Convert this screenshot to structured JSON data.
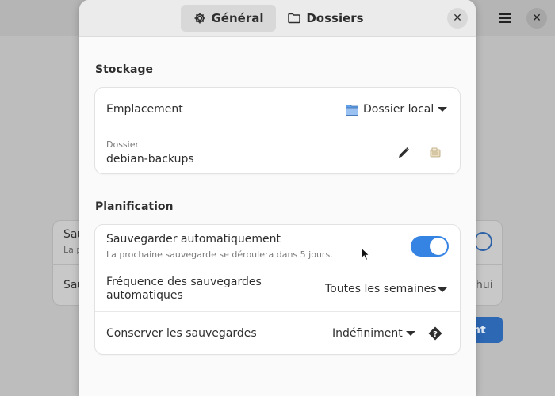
{
  "background": {
    "row1_label": "Sau",
    "row1_sub": "La p",
    "row2_label": "Sau",
    "row2_value": "hui",
    "button_label": "nt"
  },
  "dialog": {
    "tabs": [
      {
        "label": "Général",
        "icon": "gear-icon",
        "active": true
      },
      {
        "label": "Dossiers",
        "icon": "folder-icon",
        "active": false
      }
    ],
    "close_icon": "close-icon"
  },
  "storage": {
    "title": "Stockage",
    "location_label": "Emplacement",
    "location_value": "Dossier local",
    "folder_label": "Dossier",
    "folder_value": "debian-backups"
  },
  "schedule": {
    "title": "Planification",
    "auto_label": "Sauvegarder automatiquement",
    "auto_sub": "La prochaine sauvegarde se déroulera dans 5 jours.",
    "auto_enabled": true,
    "frequency_label_line1": "Fréquence des sauvegardes",
    "frequency_label_line2": "automatiques",
    "frequency_value": "Toutes les semaines",
    "keep_label": "Conserver les sauvegardes",
    "keep_value": "Indéfiniment"
  },
  "colors": {
    "accent": "#3584e4",
    "dialog_bg": "#fafafa",
    "card_bg": "#ffffff"
  }
}
